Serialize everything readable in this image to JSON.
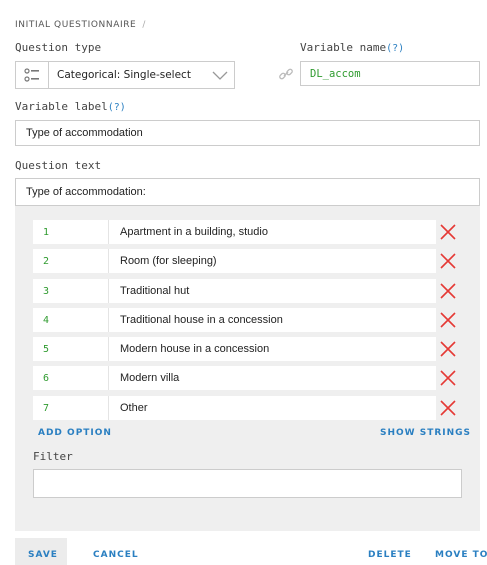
{
  "breadcrumb": {
    "section": "INITIAL QUESTIONNAIRE",
    "separator": "/"
  },
  "question_type": {
    "label": "Question type",
    "value": "Categorical: Single-select"
  },
  "variable_name": {
    "label": "Variable name",
    "help": "(?)",
    "value": "DL_accom"
  },
  "variable_label": {
    "label": "Variable label",
    "help": "(?)",
    "value": "Type of accommodation"
  },
  "question_text": {
    "label": "Question text",
    "value": "Type of accommodation:"
  },
  "options": [
    {
      "code": "1",
      "title": "Apartment in a building, studio"
    },
    {
      "code": "2",
      "title": "Room (for sleeping)"
    },
    {
      "code": "3",
      "title": "Traditional hut"
    },
    {
      "code": "4",
      "title": "Traditional house in a concession"
    },
    {
      "code": "5",
      "title": "Modern house in a concession"
    },
    {
      "code": "6",
      "title": "Modern villa"
    },
    {
      "code": "7",
      "title": "Other"
    }
  ],
  "actions": {
    "add_option": "ADD OPTION",
    "show_strings": "SHOW STRINGS"
  },
  "filter": {
    "label": "Filter",
    "value": ""
  },
  "footer": {
    "save": "SAVE",
    "cancel": "CANCEL",
    "delete": "DELETE",
    "move_to": "MOVE TO"
  },
  "colors": {
    "accent": "#2a7fc1",
    "code_green": "#2f9b2f",
    "delete_red": "#e53935"
  }
}
